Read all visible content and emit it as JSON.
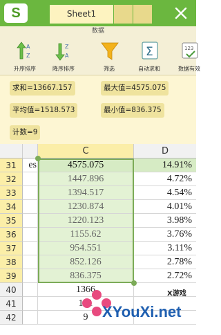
{
  "app": {
    "logo": "S",
    "active_tab": "Sheet1"
  },
  "ribbon": {
    "title": "数据",
    "buttons": [
      {
        "label": "升序排序",
        "icon": "sort-ascending-icon"
      },
      {
        "label": "降序排序",
        "icon": "sort-descending-icon"
      },
      {
        "label": "筛选",
        "icon": "filter-icon"
      },
      {
        "label": "自动求和",
        "icon": "sum-icon"
      },
      {
        "label": "数据有效",
        "icon": "data-validation-icon"
      }
    ]
  },
  "stats": {
    "sum": "求和=13667.157",
    "max": "最大值=4575.075",
    "avg": "平均值=1518.573",
    "min": "最小值=836.375",
    "count": "计数=9"
  },
  "sheet": {
    "columns": [
      "C",
      "D"
    ],
    "rows": [
      {
        "num": "31",
        "b": "es",
        "c": "4575.075",
        "d": "14.91%"
      },
      {
        "num": "32",
        "b": "",
        "c": "1447.896",
        "d": "4.72%"
      },
      {
        "num": "33",
        "b": "",
        "c": "1394.517",
        "d": "4.54%"
      },
      {
        "num": "34",
        "b": "",
        "c": "1230.874",
        "d": "4.01%"
      },
      {
        "num": "35",
        "b": "",
        "c": "1220.123",
        "d": "3.98%"
      },
      {
        "num": "36",
        "b": "",
        "c": "1155.62",
        "d": "3.76%"
      },
      {
        "num": "37",
        "b": "",
        "c": "954.551",
        "d": "3.11%"
      },
      {
        "num": "38",
        "b": "",
        "c": "852.126",
        "d": "2.78%"
      },
      {
        "num": "39",
        "b": "",
        "c": "836.375",
        "d": "2.72%"
      },
      {
        "num": "40",
        "b": "",
        "c": "1366",
        "d": ""
      },
      {
        "num": "41",
        "b": "",
        "c": "151",
        "d": ""
      },
      {
        "num": "42",
        "b": "",
        "c": "9",
        "d": ""
      }
    ]
  },
  "watermark": {
    "brand": "XYouXi.net",
    "tag": "X游戏"
  },
  "colors": {
    "titlebar": "#6bb73f",
    "selection": "#e3f2d4",
    "selection_border": "#7cab58"
  }
}
